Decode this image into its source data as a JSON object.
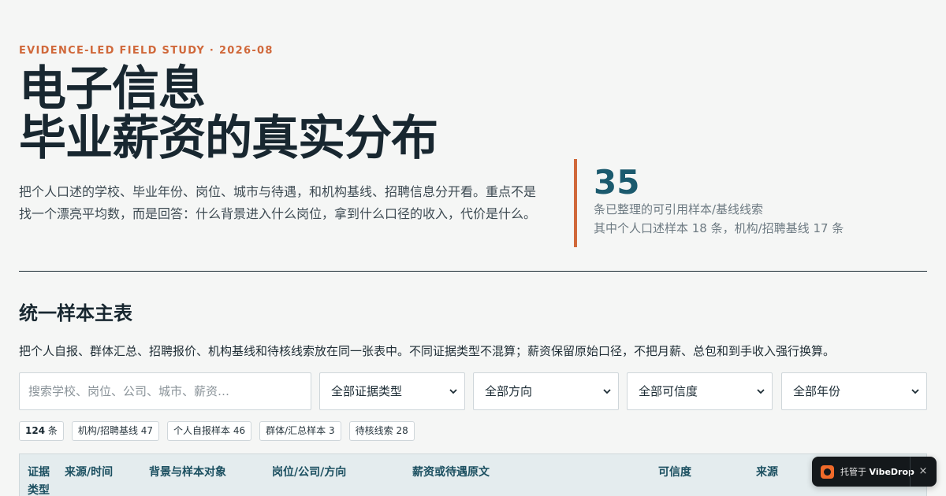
{
  "header": {
    "eyebrow": "EVIDENCE-LED FIELD STUDY · 2026-08",
    "title_line1": "电子信息",
    "title_line2": "毕业薪资的真实分布",
    "intro": "把个人口述的学校、毕业年份、岗位、城市与待遇，和机构基线、招聘信息分开看。重点不是找一个漂亮平均数，而是回答：什么背景进入什么岗位，拿到什么口径的收入，代价是什么。"
  },
  "stat": {
    "value": "35",
    "line1": "条已整理的可引用样本/基线线索",
    "line2": "其中个人口述样本 18 条，机构/招聘基线 17 条"
  },
  "section": {
    "title": "统一样本主表",
    "desc": "把个人自报、群体汇总、招聘报价、机构基线和待核线索放在同一张表中。不同证据类型不混算；薪资保留原始口径，不把月薪、总包和到手收入强行换算。"
  },
  "filters": {
    "search_placeholder": "搜索学校、岗位、公司、城市、薪资…",
    "evidence_type": "全部证据类型",
    "direction": "全部方向",
    "credibility": "全部可信度",
    "year": "全部年份"
  },
  "chips": {
    "total_count": "124",
    "total_unit": "条",
    "institution": "机构/招聘基线 47",
    "self_report": "个人自报样本 46",
    "group": "群体/汇总样本 3",
    "pending": "待核线索 28"
  },
  "table": {
    "columns": [
      "证据类型",
      "来源/时间",
      "背景与样本对象",
      "岗位/公司/方向",
      "薪资或待遇原文",
      "可信度",
      "来源"
    ]
  },
  "toast": {
    "prefix": "托管于",
    "brand": "VibeDrop",
    "close": "×"
  },
  "colors": {
    "accent": "#d0683a",
    "primary": "#1b5a6e",
    "background": "#f5f6f5"
  }
}
